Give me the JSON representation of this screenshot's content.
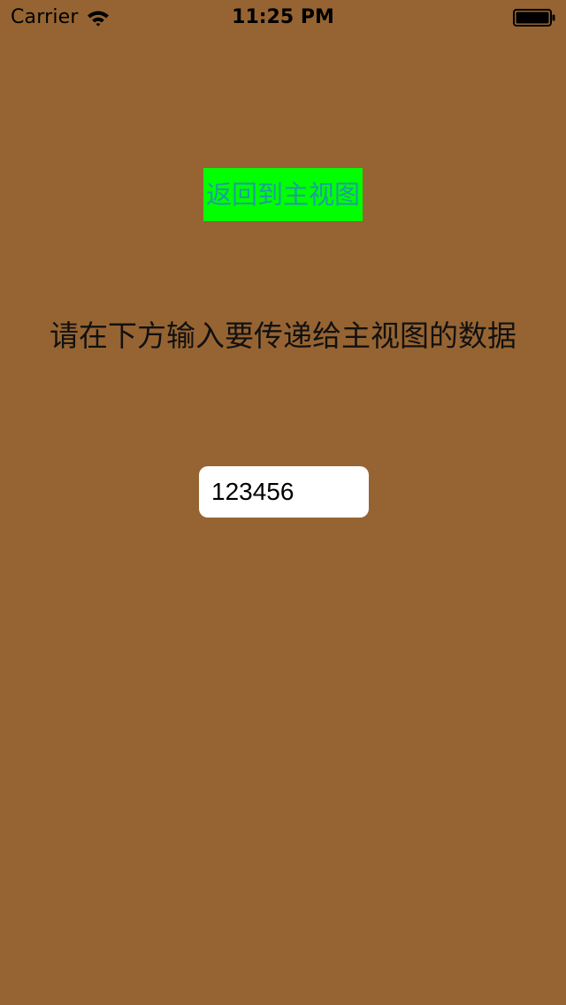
{
  "status_bar": {
    "carrier": "Carrier",
    "time": "11:25 PM",
    "wifi_icon": "wifi-icon",
    "battery_icon": "battery-full-icon"
  },
  "main": {
    "back_button_label": "返回到主视图",
    "prompt_text": "请在下方输入要传递给主视图的数据",
    "data_field_value": "123456"
  },
  "colors": {
    "background": "#966432",
    "button_background": "#00ff00",
    "button_text": "#1e9ea0",
    "prompt_text": "#111111",
    "field_background": "#ffffff"
  }
}
